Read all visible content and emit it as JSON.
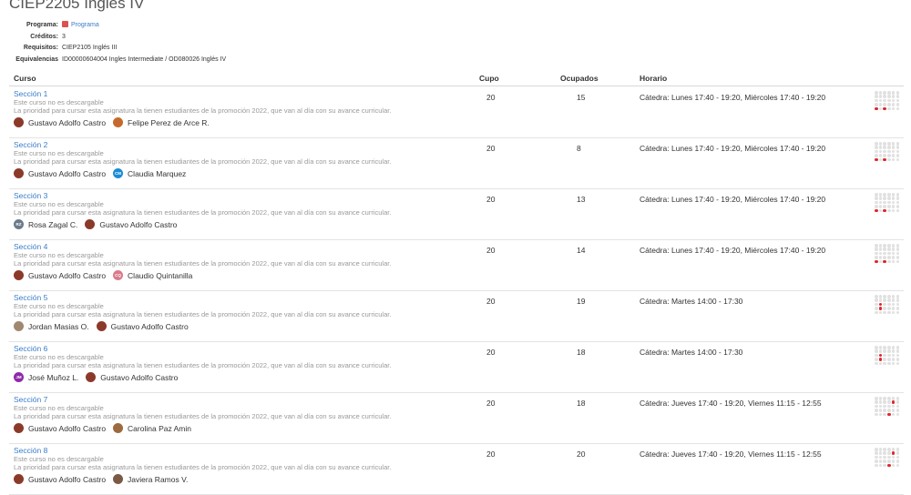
{
  "page": {
    "title": "CIEP2205 Inglés IV"
  },
  "meta": {
    "programa_label": "Programa:",
    "programa_value": "Programa",
    "creditos_label": "Créditos:",
    "creditos_value": "3",
    "requisitos_label": "Requisitos:",
    "requisitos_value": "CIEP2105 Inglés III",
    "equivalencias_label": "Equivalencias",
    "equivalencias_value": "ID00000604004 Ingles Intermediate / OD080026 Inglés IV"
  },
  "colors": {
    "accent": "#3a7dc9",
    "active_slot": "#e0262b"
  },
  "table": {
    "headers": {
      "curso": "Curso",
      "cupo": "Cupo",
      "ocupados": "Ocupados",
      "horario": "Horario"
    },
    "rows": [
      {
        "seccion": "Sección 1",
        "note1": "Este curso no es descargable",
        "note2": "La prioridad para cursar esta asignatura la tienen estudiantes de la promoción 2022, que van al día con su avance curricular.",
        "profs": [
          {
            "name": "Gustavo Adolfo Castro",
            "initials": "",
            "color": "#8b3a2a"
          },
          {
            "name": "Felipe Perez de Arce R.",
            "initials": "",
            "color": "#c46a2c"
          }
        ],
        "cupo": "20",
        "ocupados": "15",
        "horario": "Cátedra: Lunes 17:40 - 19:20, Miércoles 17:40 - 19:20",
        "slots": [
          "4-0",
          "4-2"
        ]
      },
      {
        "seccion": "Sección 2",
        "note1": "Este curso no es descargable",
        "note2": "La prioridad para cursar esta asignatura la tienen estudiantes de la promoción 2022, que van al día con su avance curricular.",
        "profs": [
          {
            "name": "Gustavo Adolfo Castro",
            "initials": "",
            "color": "#8b3a2a"
          },
          {
            "name": "Claudia Marquez",
            "initials": "CM",
            "color": "#1a8bd6"
          }
        ],
        "cupo": "20",
        "ocupados": "8",
        "horario": "Cátedra: Lunes 17:40 - 19:20, Miércoles 17:40 - 19:20",
        "slots": [
          "4-0",
          "4-2"
        ]
      },
      {
        "seccion": "Sección 3",
        "note1": "Este curso no es descargable",
        "note2": "La prioridad para cursar esta asignatura la tienen estudiantes de la promoción 2022, que van al día con su avance curricular.",
        "profs": [
          {
            "name": "Rosa Zagal C.",
            "initials": "RZ",
            "color": "#6b7b8c"
          },
          {
            "name": "Gustavo Adolfo Castro",
            "initials": "",
            "color": "#8b3a2a"
          }
        ],
        "cupo": "20",
        "ocupados": "13",
        "horario": "Cátedra: Lunes 17:40 - 19:20, Miércoles 17:40 - 19:20",
        "slots": [
          "4-0",
          "4-2"
        ]
      },
      {
        "seccion": "Sección 4",
        "note1": "Este curso no es descargable",
        "note2": "La prioridad para cursar esta asignatura la tienen estudiantes de la promoción 2022, que van al día con su avance curricular.",
        "profs": [
          {
            "name": "Gustavo Adolfo Castro",
            "initials": "",
            "color": "#8b3a2a"
          },
          {
            "name": "Claudio Quintanilla",
            "initials": "CQ",
            "color": "#d97a8a"
          }
        ],
        "cupo": "20",
        "ocupados": "14",
        "horario": "Cátedra: Lunes 17:40 - 19:20, Miércoles 17:40 - 19:20",
        "slots": [
          "4-0",
          "4-2"
        ]
      },
      {
        "seccion": "Sección 5",
        "note1": "Este curso no es descargable",
        "note2": "La prioridad para cursar esta asignatura la tienen estudiantes de la promoción 2022, que van al día con su avance curricular.",
        "profs": [
          {
            "name": "Jordan Masias O.",
            "initials": "",
            "color": "#a08870"
          },
          {
            "name": "Gustavo Adolfo Castro",
            "initials": "",
            "color": "#8b3a2a"
          }
        ],
        "cupo": "20",
        "ocupados": "19",
        "horario": "Cátedra: Martes 14:00 - 17:30",
        "slots": [
          "2-1",
          "3-1"
        ]
      },
      {
        "seccion": "Sección 6",
        "note1": "Este curso no es descargable",
        "note2": "La prioridad para cursar esta asignatura la tienen estudiantes de la promoción 2022, que van al día con su avance curricular.",
        "profs": [
          {
            "name": "José Muñoz L.",
            "initials": "JM",
            "color": "#8e2aa8"
          },
          {
            "name": "Gustavo Adolfo Castro",
            "initials": "",
            "color": "#8b3a2a"
          }
        ],
        "cupo": "20",
        "ocupados": "18",
        "horario": "Cátedra: Martes 14:00 - 17:30",
        "slots": [
          "2-1",
          "3-1"
        ]
      },
      {
        "seccion": "Sección 7",
        "note1": "Este curso no es descargable",
        "note2": "La prioridad para cursar esta asignatura la tienen estudiantes de la promoción 2022, que van al día con su avance curricular.",
        "profs": [
          {
            "name": "Gustavo Adolfo Castro",
            "initials": "",
            "color": "#8b3a2a"
          },
          {
            "name": "Carolina Paz Amin",
            "initials": "",
            "color": "#9c6a3e"
          }
        ],
        "cupo": "20",
        "ocupados": "18",
        "horario": "Cátedra: Jueves 17:40 - 19:20, Viernes 11:15 - 12:55",
        "slots": [
          "1-4",
          "4-3"
        ]
      },
      {
        "seccion": "Sección 8",
        "note1": "Este curso no es descargable",
        "note2": "La prioridad para cursar esta asignatura la tienen estudiantes de la promoción 2022, que van al día con su avance curricular.",
        "profs": [
          {
            "name": "Gustavo Adolfo Castro",
            "initials": "",
            "color": "#8b3a2a"
          },
          {
            "name": "Javiera Ramos V.",
            "initials": "",
            "color": "#7a5a44"
          }
        ],
        "cupo": "20",
        "ocupados": "20",
        "horario": "Cátedra: Jueves 17:40 - 19:20, Viernes 11:15 - 12:55",
        "slots": [
          "1-4",
          "4-3"
        ]
      }
    ]
  }
}
